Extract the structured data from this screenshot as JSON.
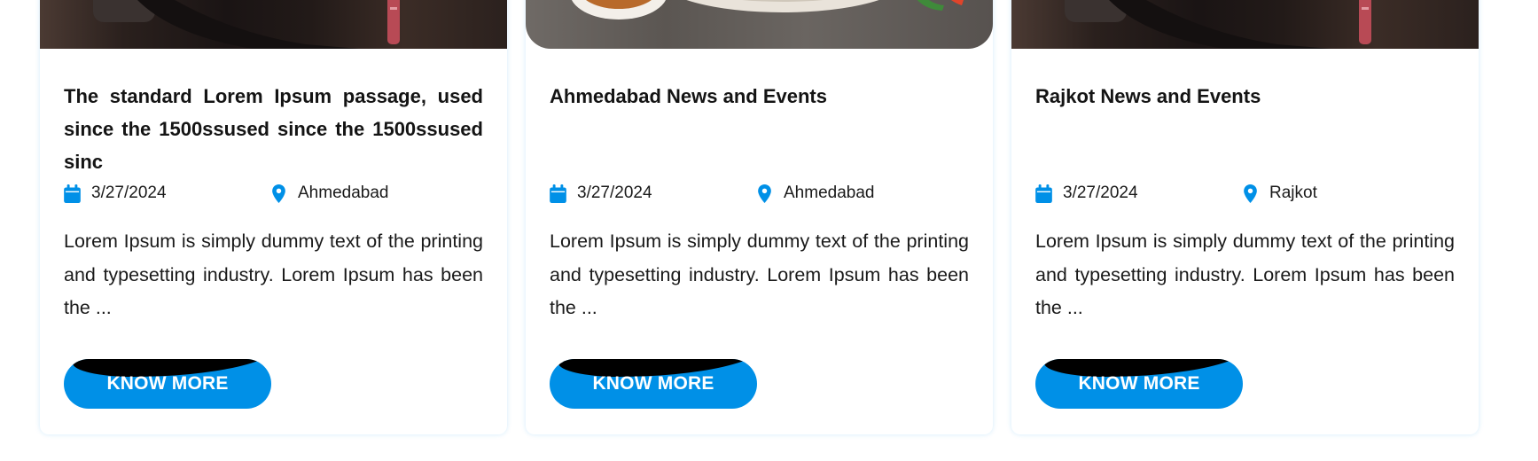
{
  "colors": {
    "accent": "#0090E7",
    "text": "#141414",
    "card_border": "#D8EEFB"
  },
  "cards": [
    {
      "title": "The standard Lorem Ipsum passage, used since the 1500ssused since the 1500ssused sinc",
      "date": "3/27/2024",
      "location": "Ahmedabad",
      "description": "Lorem Ipsum is simply dummy text of the printing and typesetting industry. Lorem Ipsum has been the ...",
      "button_label": "KNOW MORE",
      "date_icon": "calendar-icon",
      "location_icon": "map-pin-icon"
    },
    {
      "title": "Ahmedabad News and Events",
      "date": "3/27/2024",
      "location": "Ahmedabad",
      "description": "Lorem Ipsum is simply dummy text of the printing and typesetting industry. Lorem Ipsum has been the ...",
      "button_label": "KNOW MORE",
      "date_icon": "calendar-icon",
      "location_icon": "map-pin-icon"
    },
    {
      "title": "Rajkot News and Events",
      "date": "3/27/2024",
      "location": "Rajkot",
      "description": "Lorem Ipsum is simply dummy text of the printing and typesetting industry. Lorem Ipsum has been the ...",
      "button_label": "KNOW MORE",
      "date_icon": "calendar-icon",
      "location_icon": "map-pin-icon"
    }
  ]
}
